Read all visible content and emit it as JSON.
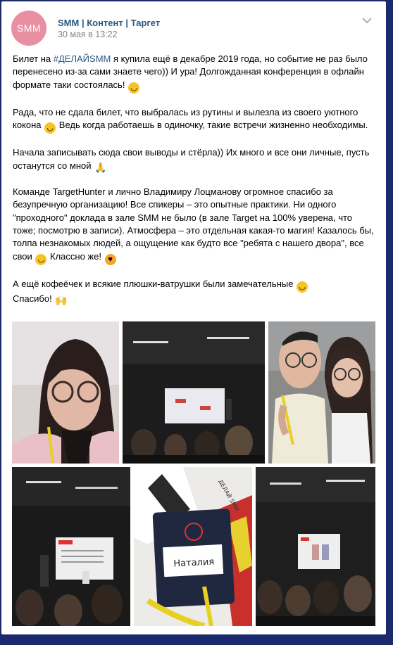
{
  "post": {
    "author": "SMM | Контент | Таргет",
    "date": "30 мая в 13:22",
    "avatar_text": "SMM",
    "p1_a": "Билет на ",
    "p1_tag": "#ДЕЛАЙSMM",
    "p1_b": " я купила ещё в декабре 2019 года, но событие не раз было перенесено из-за сами знаете чего)) И ура! Долгожданная конференция в офлайн формате таки состоялась!",
    "p2_a": "Рада, что не сдала билет, что выбралась из рутины и вылезла из своего уютного кокона",
    "p2_b": " Ведь когда работаешь в одиночку, такие встречи жизненно необходимы.",
    "p3_a": "Начала записывать сюда свои выводы и стёрла)) Их много и все они личные, пусть останутся со мной",
    "p4_a": "Команде TargetHunter и лично Владимиру Лоцманову огромное спасибо за безупречную организацию! Все спикеры – это опытные практики. Ни одного \"проходного\" доклада в зале SMM не было (в зале Target на 100% уверена, что тоже; посмотрю в записи). Атмосфера – это отдельная какая-то магия! Казалось бы, толпа незнакомых людей, а ощущение как будто все \"ребята с нашего двора\", все свои",
    "p4_b": " Классно же!",
    "p5_a": "А ещё кофеёчек и всякие плюшки-ватрушки были замечательные",
    "p5_b": "Спасибо!",
    "badge_name": "Наталия",
    "lanyard_text": "ДЕЛАЙ SMM"
  },
  "colors": {
    "link": "#2a5885",
    "muted": "#828282",
    "avatar_bg": "#e88fa1",
    "frame": "#1a2a6c"
  },
  "icons": {
    "menu": "chevron-down-icon",
    "emojis": [
      "smiling-face",
      "grinning-face",
      "folded-hands",
      "smiling-face",
      "smiling-face-with-hearts",
      "face-savoring-food",
      "raising-hands"
    ]
  }
}
